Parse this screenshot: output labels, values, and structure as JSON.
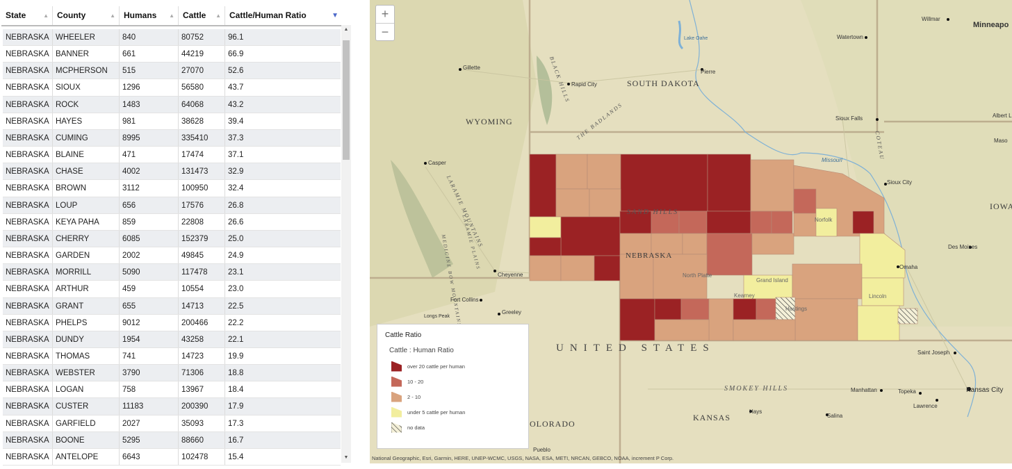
{
  "table": {
    "columns": [
      "State",
      "County",
      "Humans",
      "Cattle",
      "Cattle/Human Ratio"
    ],
    "rows": [
      [
        "NEBRASKA",
        "WHEELER",
        "840",
        "80752",
        "96.1"
      ],
      [
        "NEBRASKA",
        "BANNER",
        "661",
        "44219",
        "66.9"
      ],
      [
        "NEBRASKA",
        "MCPHERSON",
        "515",
        "27070",
        "52.6"
      ],
      [
        "NEBRASKA",
        "SIOUX",
        "1296",
        "56580",
        "43.7"
      ],
      [
        "NEBRASKA",
        "ROCK",
        "1483",
        "64068",
        "43.2"
      ],
      [
        "NEBRASKA",
        "HAYES",
        "981",
        "38628",
        "39.4"
      ],
      [
        "NEBRASKA",
        "CUMING",
        "8995",
        "335410",
        "37.3"
      ],
      [
        "NEBRASKA",
        "BLAINE",
        "471",
        "17474",
        "37.1"
      ],
      [
        "NEBRASKA",
        "CHASE",
        "4002",
        "131473",
        "32.9"
      ],
      [
        "NEBRASKA",
        "BROWN",
        "3112",
        "100950",
        "32.4"
      ],
      [
        "NEBRASKA",
        "LOUP",
        "656",
        "17576",
        "26.8"
      ],
      [
        "NEBRASKA",
        "KEYA PAHA",
        "859",
        "22808",
        "26.6"
      ],
      [
        "NEBRASKA",
        "CHERRY",
        "6085",
        "152379",
        "25.0"
      ],
      [
        "NEBRASKA",
        "GARDEN",
        "2002",
        "49845",
        "24.9"
      ],
      [
        "NEBRASKA",
        "MORRILL",
        "5090",
        "117478",
        "23.1"
      ],
      [
        "NEBRASKA",
        "ARTHUR",
        "459",
        "10554",
        "23.0"
      ],
      [
        "NEBRASKA",
        "GRANT",
        "655",
        "14713",
        "22.5"
      ],
      [
        "NEBRASKA",
        "PHELPS",
        "9012",
        "200466",
        "22.2"
      ],
      [
        "NEBRASKA",
        "DUNDY",
        "1954",
        "43258",
        "22.1"
      ],
      [
        "NEBRASKA",
        "THOMAS",
        "741",
        "14723",
        "19.9"
      ],
      [
        "NEBRASKA",
        "WEBSTER",
        "3790",
        "71306",
        "18.8"
      ],
      [
        "NEBRASKA",
        "LOGAN",
        "758",
        "13967",
        "18.4"
      ],
      [
        "NEBRASKA",
        "CUSTER",
        "11183",
        "200390",
        "17.9"
      ],
      [
        "NEBRASKA",
        "GARFIELD",
        "2027",
        "35093",
        "17.3"
      ],
      [
        "NEBRASKA",
        "BOONE",
        "5295",
        "88660",
        "16.7"
      ],
      [
        "NEBRASKA",
        "ANTELOPE",
        "6643",
        "102478",
        "15.4"
      ]
    ]
  },
  "map": {
    "zoom_in": "+",
    "zoom_out": "−",
    "legend": {
      "title": "Cattle Ratio",
      "subtitle": "Cattle : Human Ratio",
      "items": [
        {
          "label": "over 20 cattle per human",
          "color": "#9b2224"
        },
        {
          "label": "10 - 20",
          "color": "#c4685a"
        },
        {
          "label": "2 - 10",
          "color": "#d9a37e"
        },
        {
          "label": "under 5 cattle per human",
          "color": "#f2ee9e"
        },
        {
          "label": "no data",
          "color": "hatch"
        }
      ]
    },
    "labels": {
      "south_dakota": "SOUTH DAKOTA",
      "wyoming": "WYOMING",
      "nebraska": "NEBRASKA",
      "kansas": "KANSAS",
      "iowa": "IOWA",
      "united_states": "UNITED STATES",
      "colorado": "OLORADO",
      "smokey_hills": "SMOKEY HILLS",
      "sand_hills": "SAND HILLS",
      "the_badlands": "THE BADLANDS",
      "black_hills": "BLACK HILLS",
      "laramie_mountains": "LARAMIE MOUNTAINS",
      "laramie_plains": "LARAMIE PLAINS",
      "medicine_bow": "MEDICINE BOW MOUNTAINS",
      "missouri": "Missouri",
      "lake_oahe": "Lake Oahe",
      "coteau": "COTEAU",
      "gillette": "Gillette",
      "rapid_city": "Rapid City",
      "pierre": "Pierre",
      "watertown": "Watertown",
      "willmar": "Willmar",
      "minneapolis": "Minneapo",
      "albert_lea": "Albert L",
      "mason": "Maso",
      "sioux_falls": "Sioux Falls",
      "sioux_city": "Sioux City",
      "casper": "Casper",
      "norfolk": "Norfolk",
      "north_platte": "North Platte",
      "grand_island": "Grand Island",
      "kearney": "Kearney",
      "hastings": "Hastings",
      "lincoln": "Lincoln",
      "omaha": "Omaha",
      "des_moines": "Des Moines",
      "cheyenne": "Cheyenne",
      "fort_collins": "Fort Collins",
      "greeley": "Greeley",
      "longs_peak": "Longs Peak",
      "saint_joseph": "Saint Joseph",
      "manhattan": "Manhattan",
      "topeka": "Topeka",
      "kansas_city": "Kansas City",
      "lawrence": "Lawrence",
      "hays": "Hays",
      "salina": "Salina",
      "pueblo": "Pueblo"
    },
    "attribution": "National Geographic, Esri, Garmin, HERE, UNEP-WCMC, USGS, NASA, ESA, METI, NRCAN, GEBCO, NOAA, increment P Corp."
  }
}
